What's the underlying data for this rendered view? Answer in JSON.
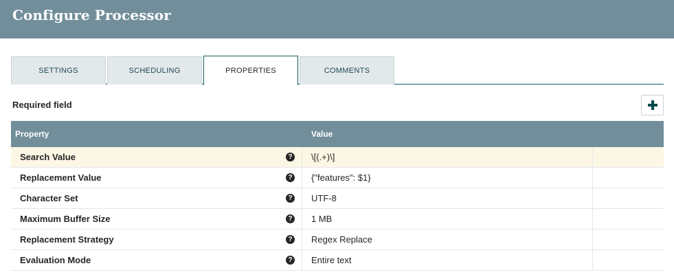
{
  "dialog": {
    "title": "Configure Processor"
  },
  "tabs": [
    {
      "label": "SETTINGS",
      "active": false
    },
    {
      "label": "SCHEDULING",
      "active": false
    },
    {
      "label": "PROPERTIES",
      "active": true
    },
    {
      "label": "COMMENTS",
      "active": false
    }
  ],
  "required_label": "Required field",
  "add_icon": "plus-icon",
  "table": {
    "columns": [
      "Property",
      "Value"
    ],
    "help_icon": "question-circle-icon",
    "rows": [
      {
        "property": "Search Value",
        "value": "\\[(.+)\\]",
        "selected": true
      },
      {
        "property": "Replacement Value",
        "value": "{\"features\": $1}",
        "selected": false
      },
      {
        "property": "Character Set",
        "value": "UTF-8",
        "selected": false
      },
      {
        "property": "Maximum Buffer Size",
        "value": "1 MB",
        "selected": false
      },
      {
        "property": "Replacement Strategy",
        "value": "Regex Replace",
        "selected": false
      },
      {
        "property": "Evaluation Mode",
        "value": "Entire text",
        "selected": false
      }
    ]
  },
  "colors": {
    "header_bg": "#728e9b",
    "selected_row": "#fcf6e4",
    "accent": "#004849"
  }
}
